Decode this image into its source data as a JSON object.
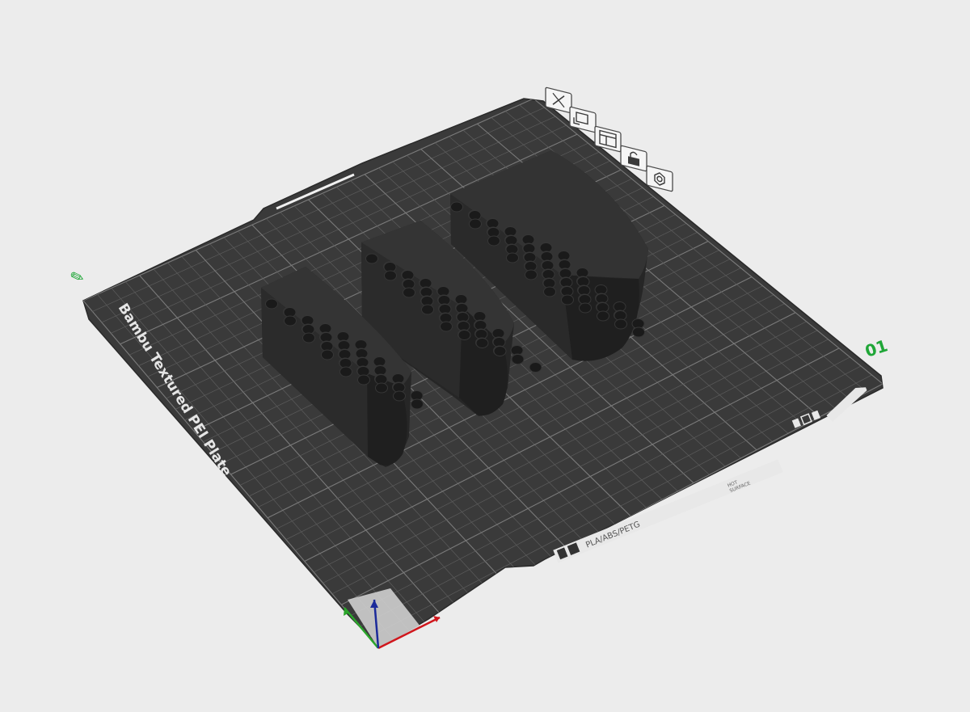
{
  "app": "Bambu Studio 3D view",
  "plate": {
    "name_label": "Bambu Textured PEI Plate",
    "number": "01",
    "edit_indicator": "✎",
    "material_label": "PLA/ABS/PETG",
    "hot_surface_line1": "HOT",
    "hot_surface_line2": "SURFACE"
  },
  "plate_toolbar": [
    {
      "name": "remove-plate-button",
      "icon": "close-icon"
    },
    {
      "name": "arrange-plate-button",
      "icon": "arrange-icon"
    },
    {
      "name": "orient-plate-button",
      "icon": "orient-icon"
    },
    {
      "name": "lock-plate-button",
      "icon": "lock-icon"
    },
    {
      "name": "plate-settings-button",
      "icon": "gear-icon"
    }
  ],
  "objects": [
    {
      "name": "small-holder",
      "holes": "hex pattern"
    },
    {
      "name": "medium-holder",
      "holes": "hex pattern"
    },
    {
      "name": "large-holder",
      "holes": "hex pattern"
    }
  ],
  "colors": {
    "background": "#ececec",
    "plate": "#3a3a3a",
    "grid": "#6a6a6a",
    "object": "#2d2d2d",
    "accent_green": "#1fa637",
    "axis_x": "#d0161c",
    "axis_y": "#2aa52a",
    "axis_z": "#1b2a9a"
  }
}
